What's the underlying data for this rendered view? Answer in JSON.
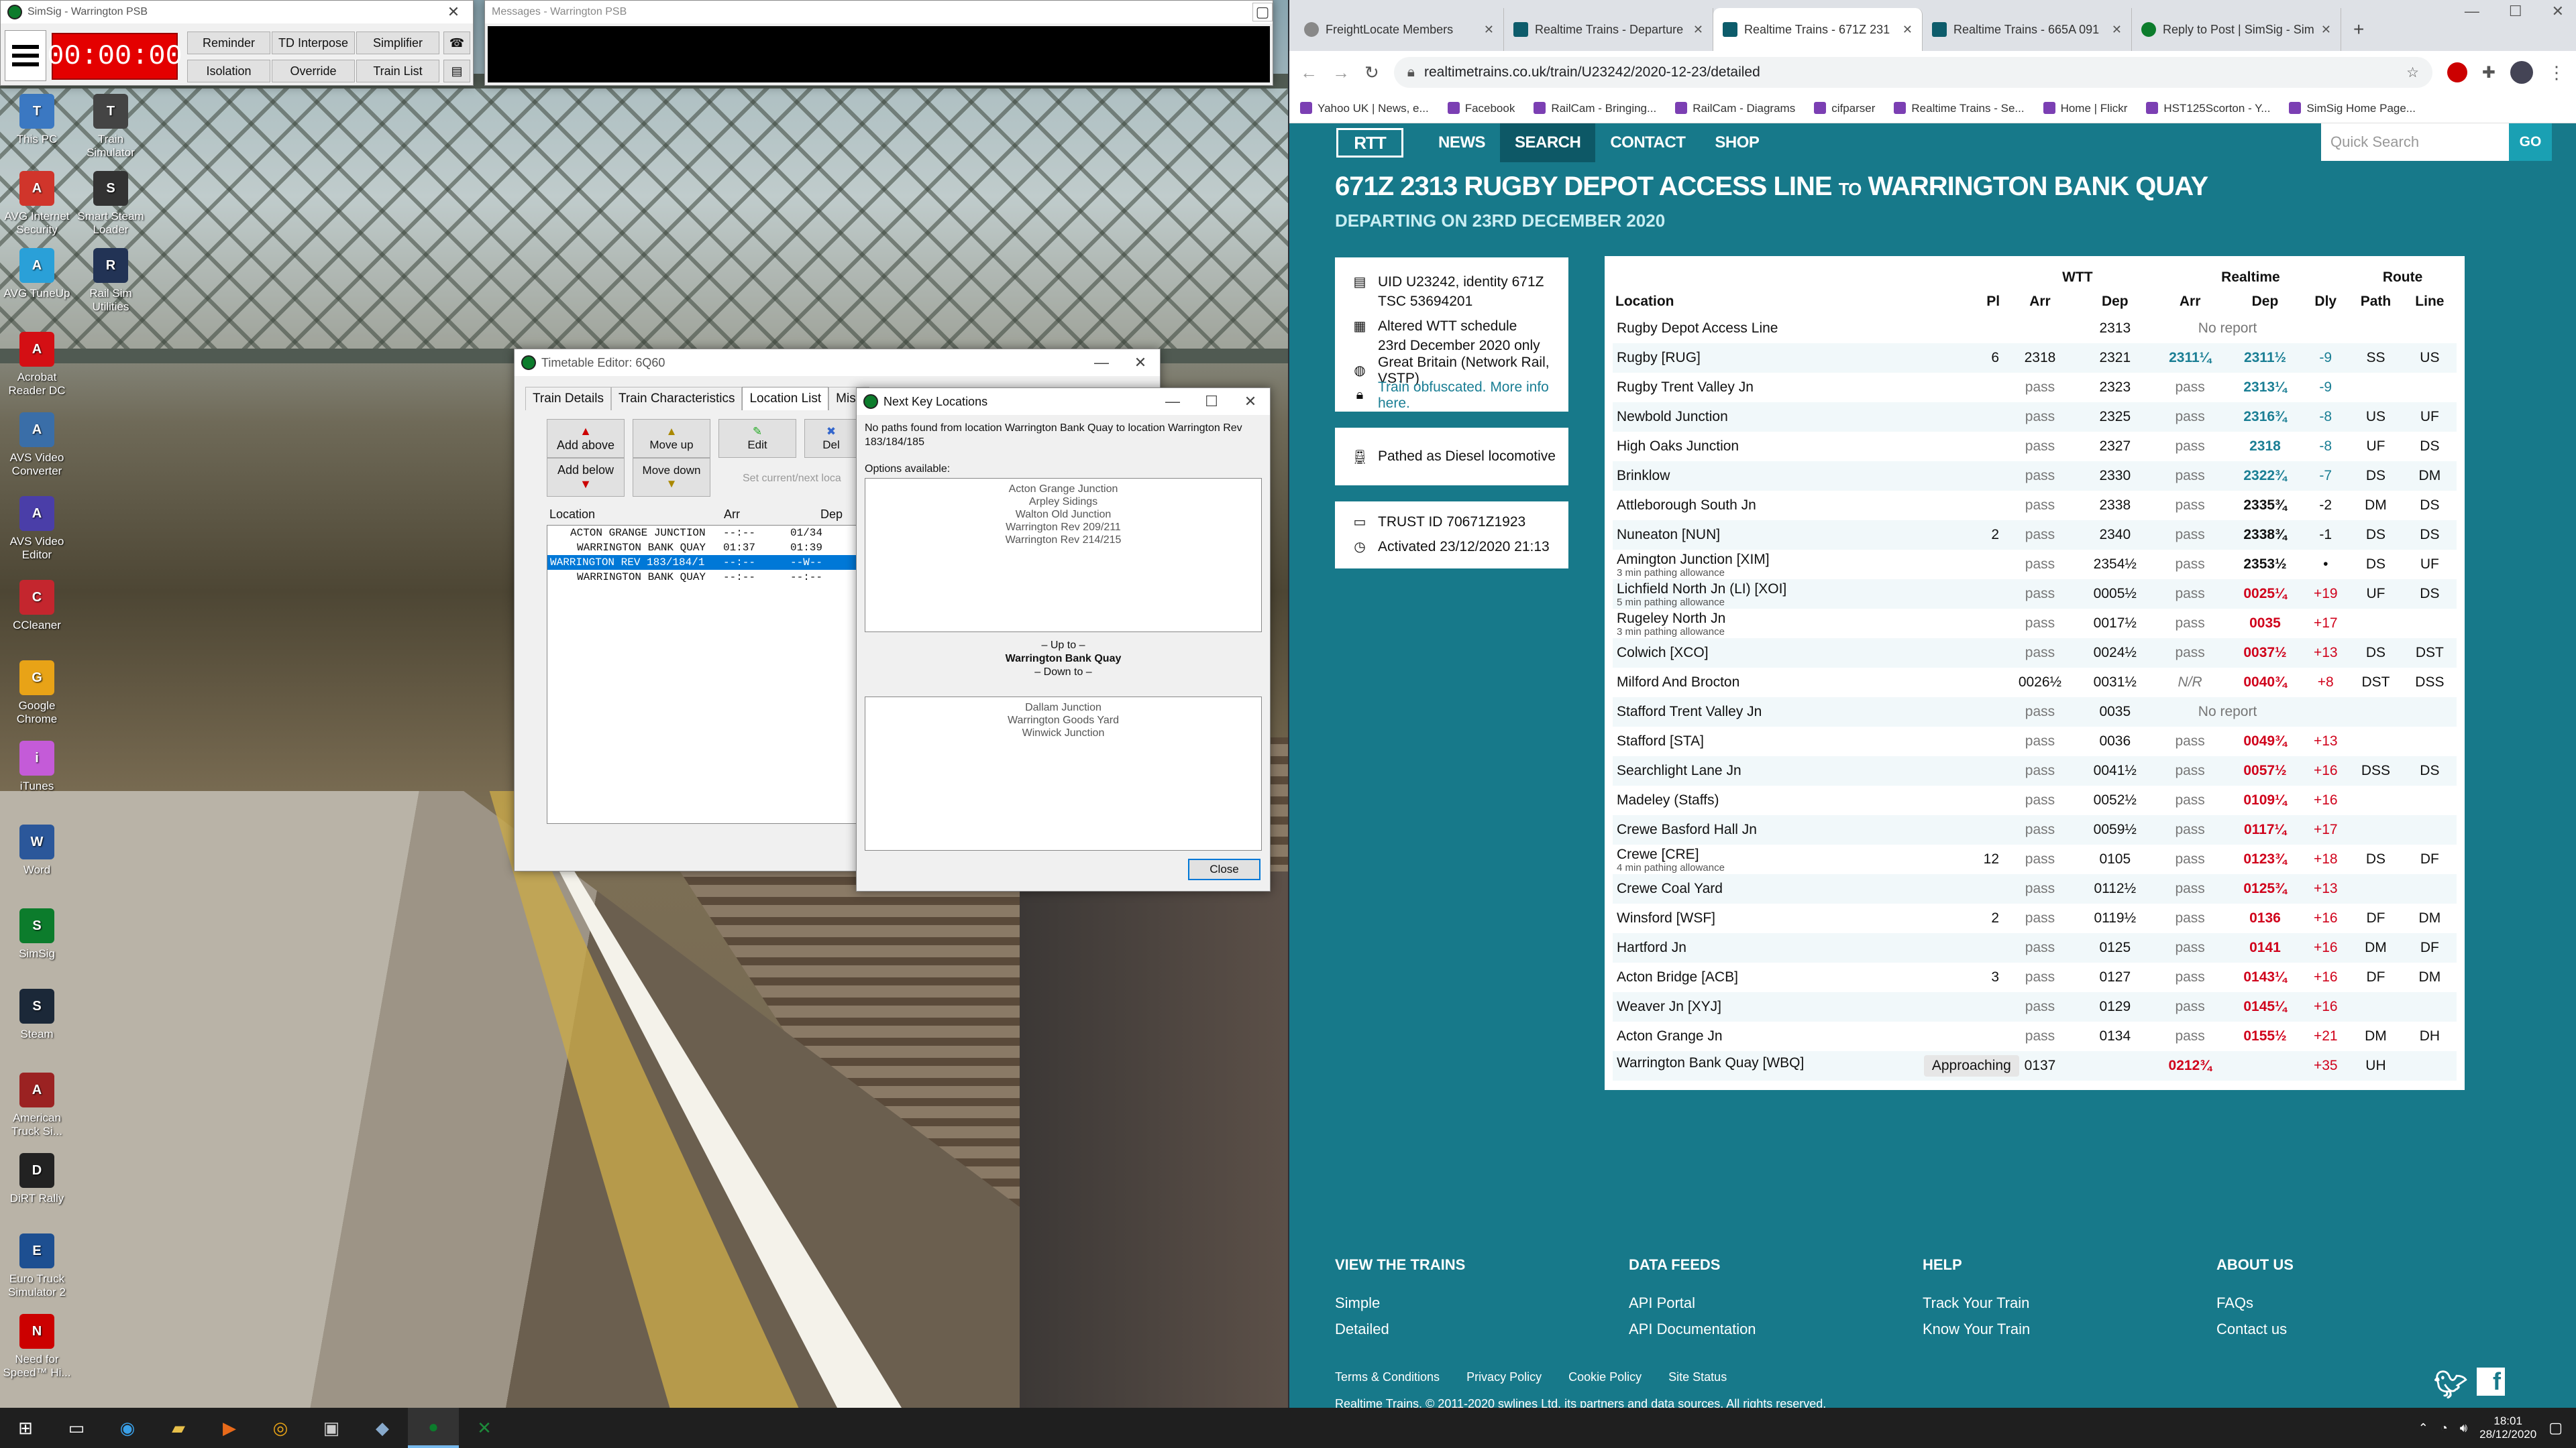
{
  "desktop": {
    "icons": [
      {
        "label": "This PC",
        "color": "#3b78c2"
      },
      {
        "label": "Train Simulator",
        "color": "#444"
      },
      {
        "label": "AVG Internet Security",
        "color": "#d0352b"
      },
      {
        "label": "Smart Steam Loader",
        "color": "#333"
      },
      {
        "label": "AVG TuneUp",
        "color": "#2aa0d8"
      },
      {
        "label": "Rail Sim Utilities",
        "color": "#235"
      },
      {
        "label": "Acrobat Reader DC",
        "color": "#d40f14"
      },
      {
        "label": "AVS Video Converter",
        "color": "#3a6ea8"
      },
      {
        "label": "AVS Video Editor",
        "color": "#4a3ea8"
      },
      {
        "label": "CCleaner",
        "color": "#c4262e"
      },
      {
        "label": "Google Chrome",
        "color": "#e8a317"
      },
      {
        "label": "iTunes",
        "color": "#c45bd8"
      },
      {
        "label": "Word",
        "color": "#2b579a"
      },
      {
        "label": "SimSig",
        "color": "#0c7c2c"
      },
      {
        "label": "Steam",
        "color": "#1b2838"
      },
      {
        "label": "American Truck Si...",
        "color": "#9b2222"
      },
      {
        "label": "DiRT Rally",
        "color": "#222"
      },
      {
        "label": "Euro Truck Simulator 2",
        "color": "#1d4f91"
      },
      {
        "label": "Need for Speed™ Hi...",
        "color": "#c00"
      }
    ]
  },
  "simsig": {
    "title": "SimSig - Warrington PSB",
    "clock": "00:00:00",
    "buttons": [
      "Reminder",
      "TD Interpose",
      "Simplifier",
      "Isolation",
      "Override",
      "Train List"
    ]
  },
  "messages": {
    "title": "Messages - Warrington PSB"
  },
  "timetable": {
    "title": "Timetable Editor: 6Q60",
    "tabs": [
      "Train Details",
      "Train Characteristics",
      "Location List",
      "Misc"
    ],
    "buttons": [
      "Add above",
      "Add below",
      "Move up",
      "Move down",
      "Edit",
      "Del"
    ],
    "set_current": "Set current/next loca",
    "headers": [
      "Location",
      "Arr",
      "Dep",
      "I"
    ],
    "rows": [
      [
        "ACTON GRANGE JUNCTION",
        "--:--",
        "01/34"
      ],
      [
        "WARRINGTON BANK QUAY",
        "01:37",
        "01:39"
      ],
      [
        "WARRINGTON REV 183/184/1",
        "--:--",
        "--W--"
      ],
      [
        "WARRINGTON BANK QUAY",
        "--:--",
        "--:--"
      ]
    ]
  },
  "nextkey": {
    "title": "Next Key Locations",
    "message": "No paths found from location Warrington Bank Quay to location Warrington Rev 183/184/185",
    "options_label": "Options available:",
    "options": [
      "Acton Grange Junction",
      "Arpley Sidings",
      "Walton Old Junction",
      "Warrington Rev 209/211",
      "Warrington Rev 214/215"
    ],
    "up_to": "– Up to –",
    "location": "Warrington Bank Quay",
    "down_to": "– Down to –",
    "down_options": [
      "Dallam Junction",
      "Warrington Goods Yard",
      "Winwick Junction"
    ],
    "close": "Close"
  },
  "browser": {
    "tabs": [
      {
        "title": "FreightLocate Members"
      },
      {
        "title": "Realtime Trains - Departure"
      },
      {
        "title": "Realtime Trains - 671Z 231"
      },
      {
        "title": "Realtime Trains - 665A 091"
      },
      {
        "title": "Reply to Post | SimSig - Sim"
      }
    ],
    "url": "realtimetrains.co.uk/train/U23242/2020-12-23/detailed",
    "bookmarks": [
      "Yahoo UK | News, e...",
      "Facebook",
      "RailCam - Bringing...",
      "RailCam - Diagrams",
      "cifparser",
      "Realtime Trains - Se...",
      "Home | Flickr",
      "HST125Scorton - Y...",
      "SimSig Home Page..."
    ]
  },
  "site": {
    "logo": "RTT",
    "nav": [
      "NEWS",
      "SEARCH",
      "CONTACT",
      "SHOP"
    ],
    "search_placeholder": "Quick Search",
    "go": "GO",
    "title_main": "671Z 2313 RUGBY DEPOT ACCESS LINE",
    "title_to": "TO",
    "title_dest": "WARRINGTON BANK QUAY",
    "subtitle": "DEPARTING ON 23RD DECEMBER 2020",
    "info": {
      "uid": "UID U23242, identity 671Z",
      "tsc": "TSC 53694201",
      "altered": "Altered WTT schedule",
      "date_only": "23rd December 2020 only",
      "operator": "Great Britain (Network Rail, VSTP)",
      "obfuscated": "Train obfuscated. More info here.",
      "pathed": "Pathed as Diesel locomotive",
      "trust": "TRUST ID 70671Z1923",
      "activated": "Activated 23/12/2020 21:13"
    },
    "table": {
      "group_headers": [
        "WTT",
        "Realtime",
        "Route"
      ],
      "headers": [
        "Location",
        "Pl",
        "Arr",
        "Dep",
        "Arr",
        "Dep",
        "Dly",
        "Path",
        "Line"
      ],
      "rows": [
        {
          "loc": "Rugby Depot Access Line",
          "pl": "",
          "warr": "",
          "wdep": "2313",
          "rarr": "No report",
          "rdep": "",
          "dly": "",
          "path": "",
          "line": "",
          "note": "",
          "cls": ""
        },
        {
          "loc": "Rugby [RUG]",
          "pl": "6",
          "warr": "2318",
          "wdep": "2321",
          "rarr": "2311¼",
          "rdep": "2311½",
          "dly": "-9",
          "path": "SS",
          "line": "US",
          "note": "",
          "cls": "early"
        },
        {
          "loc": "Rugby Trent Valley Jn",
          "pl": "",
          "warr": "pass",
          "wdep": "2323",
          "rarr": "pass",
          "rdep": "2313¼",
          "dly": "-9",
          "path": "",
          "line": "",
          "note": "",
          "cls": "early"
        },
        {
          "loc": "Newbold Junction",
          "pl": "",
          "warr": "pass",
          "wdep": "2325",
          "rarr": "pass",
          "rdep": "2316¾",
          "dly": "-8",
          "path": "US",
          "line": "UF",
          "note": "",
          "cls": "early"
        },
        {
          "loc": "High Oaks Junction",
          "pl": "",
          "warr": "pass",
          "wdep": "2327",
          "rarr": "pass",
          "rdep": "2318",
          "dly": "-8",
          "path": "UF",
          "line": "DS",
          "note": "",
          "cls": "early"
        },
        {
          "loc": "Brinklow",
          "pl": "",
          "warr": "pass",
          "wdep": "2330",
          "rarr": "pass",
          "rdep": "2322¾",
          "dly": "-7",
          "path": "DS",
          "line": "DM",
          "note": "",
          "cls": "early"
        },
        {
          "loc": "Attleborough South Jn",
          "pl": "",
          "warr": "pass",
          "wdep": "2338",
          "rarr": "pass",
          "rdep": "2335¾",
          "dly": "-2",
          "path": "DM",
          "line": "DS",
          "note": "",
          "cls": "bold"
        },
        {
          "loc": "Nuneaton [NUN]",
          "pl": "2",
          "warr": "pass",
          "wdep": "2340",
          "rarr": "pass",
          "rdep": "2338¾",
          "dly": "-1",
          "path": "DS",
          "line": "DS",
          "note": "",
          "cls": "bold"
        },
        {
          "loc": "Amington Junction [XIM]",
          "pl": "",
          "warr": "pass",
          "wdep": "2354½",
          "rarr": "pass",
          "rdep": "2353½",
          "dly": "•",
          "path": "DS",
          "line": "UF",
          "note": "3 min pathing allowance",
          "cls": "bold"
        },
        {
          "loc": "Lichfield North Jn (LI) [XOI]",
          "pl": "",
          "warr": "pass",
          "wdep": "0005½",
          "rarr": "pass",
          "rdep": "0025¼",
          "dly": "+19",
          "path": "UF",
          "line": "DS",
          "note": "5 min pathing allowance",
          "cls": "late"
        },
        {
          "loc": "Rugeley North Jn",
          "pl": "",
          "warr": "pass",
          "wdep": "0017½",
          "rarr": "pass",
          "rdep": "0035",
          "dly": "+17",
          "path": "",
          "line": "",
          "note": "3 min pathing allowance",
          "cls": "late"
        },
        {
          "loc": "Colwich [XCO]",
          "pl": "",
          "warr": "pass",
          "wdep": "0024½",
          "rarr": "pass",
          "rdep": "0037½",
          "dly": "+13",
          "path": "DS",
          "line": "DST",
          "note": "",
          "cls": "late"
        },
        {
          "loc": "Milford And Brocton",
          "pl": "",
          "warr": "0026½",
          "wdep": "0031½",
          "rarr": "N/R",
          "rdep": "0040¾",
          "dly": "+8",
          "path": "DST",
          "line": "DSS",
          "note": "",
          "cls": "late"
        },
        {
          "loc": "Stafford Trent Valley Jn",
          "pl": "",
          "warr": "pass",
          "wdep": "0035",
          "rarr": "No report",
          "rdep": "",
          "dly": "",
          "path": "",
          "line": "",
          "note": "",
          "cls": ""
        },
        {
          "loc": "Stafford [STA]",
          "pl": "",
          "warr": "pass",
          "wdep": "0036",
          "rarr": "pass",
          "rdep": "0049¾",
          "dly": "+13",
          "path": "",
          "line": "",
          "note": "",
          "cls": "late"
        },
        {
          "loc": "Searchlight Lane Jn",
          "pl": "",
          "warr": "pass",
          "wdep": "0041½",
          "rarr": "pass",
          "rdep": "0057½",
          "dly": "+16",
          "path": "DSS",
          "line": "DS",
          "note": "",
          "cls": "late"
        },
        {
          "loc": "Madeley (Staffs)",
          "pl": "",
          "warr": "pass",
          "wdep": "0052½",
          "rarr": "pass",
          "rdep": "0109¼",
          "dly": "+16",
          "path": "",
          "line": "",
          "note": "",
          "cls": "late"
        },
        {
          "loc": "Crewe Basford Hall Jn",
          "pl": "",
          "warr": "pass",
          "wdep": "0059½",
          "rarr": "pass",
          "rdep": "0117¼",
          "dly": "+17",
          "path": "",
          "line": "",
          "note": "",
          "cls": "late"
        },
        {
          "loc": "Crewe [CRE]",
          "pl": "12",
          "warr": "pass",
          "wdep": "0105",
          "rarr": "pass",
          "rdep": "0123¾",
          "dly": "+18",
          "path": "DS",
          "line": "DF",
          "note": "4 min pathing allowance",
          "cls": "late"
        },
        {
          "loc": "Crewe Coal Yard",
          "pl": "",
          "warr": "pass",
          "wdep": "0112½",
          "rarr": "pass",
          "rdep": "0125¾",
          "dly": "+13",
          "path": "",
          "line": "",
          "note": "",
          "cls": "late"
        },
        {
          "loc": "Winsford [WSF]",
          "pl": "2",
          "warr": "pass",
          "wdep": "0119½",
          "rarr": "pass",
          "rdep": "0136",
          "dly": "+16",
          "path": "DF",
          "line": "DM",
          "note": "",
          "cls": "late"
        },
        {
          "loc": "Hartford Jn",
          "pl": "",
          "warr": "pass",
          "wdep": "0125",
          "rarr": "pass",
          "rdep": "0141",
          "dly": "+16",
          "path": "DM",
          "line": "DF",
          "note": "",
          "cls": "late"
        },
        {
          "loc": "Acton Bridge [ACB]",
          "pl": "3",
          "warr": "pass",
          "wdep": "0127",
          "rarr": "pass",
          "rdep": "0143¼",
          "dly": "+16",
          "path": "DF",
          "line": "DM",
          "note": "",
          "cls": "late"
        },
        {
          "loc": "Weaver Jn [XYJ]",
          "pl": "",
          "warr": "pass",
          "wdep": "0129",
          "rarr": "pass",
          "rdep": "0145¼",
          "dly": "+16",
          "path": "",
          "line": "",
          "note": "",
          "cls": "late"
        },
        {
          "loc": "Acton Grange Jn",
          "pl": "",
          "warr": "pass",
          "wdep": "0134",
          "rarr": "pass",
          "rdep": "0155½",
          "dly": "+21",
          "path": "DM",
          "line": "DH",
          "note": "",
          "cls": "late"
        },
        {
          "loc": "Warrington Bank Quay [WBQ]",
          "pl": "",
          "warr": "0137",
          "wdep": "",
          "rarr": "0212¾",
          "rdep": "",
          "dly": "+35",
          "path": "UH",
          "line": "",
          "note": "",
          "cls": "late",
          "status": "Approaching"
        }
      ]
    },
    "footer": {
      "cols": [
        {
          "title": "VIEW THE TRAINS",
          "links": [
            "Simple",
            "Detailed"
          ]
        },
        {
          "title": "DATA FEEDS",
          "links": [
            "API Portal",
            "API Documentation"
          ]
        },
        {
          "title": "HELP",
          "links": [
            "Track Your Train",
            "Know Your Train"
          ]
        },
        {
          "title": "ABOUT US",
          "links": [
            "FAQs",
            "Contact us"
          ]
        }
      ],
      "legal": [
        "Terms & Conditions",
        "Privacy Policy",
        "Cookie Policy",
        "Site Status"
      ],
      "copyright": "Realtime Trains. © 2011-2020 swlines Ltd, its partners and data sources. All rights reserved."
    }
  },
  "taskbar": {
    "time": "18:01",
    "date": "28/12/2020"
  }
}
